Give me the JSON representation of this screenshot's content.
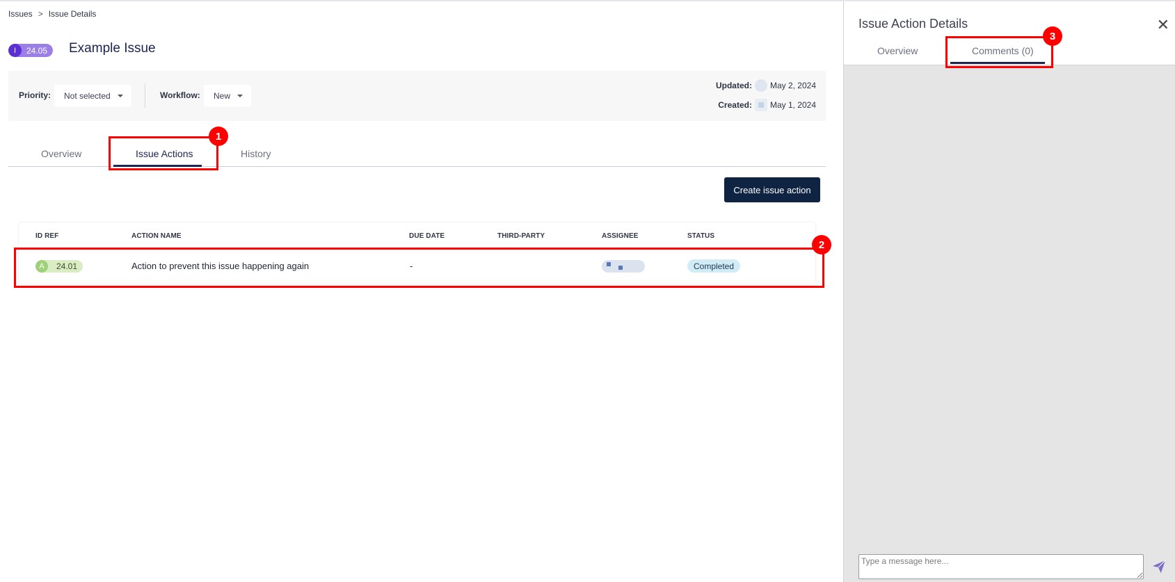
{
  "breadcrumb": {
    "root": "Issues",
    "separator": ">",
    "current": "Issue Details"
  },
  "issue": {
    "badge_letter": "I",
    "badge_number": "24.05",
    "title": "Example Issue"
  },
  "meta": {
    "priority_label": "Priority:",
    "priority_value": "Not selected",
    "workflow_label": "Workflow:",
    "workflow_value": "New",
    "updated_label": "Updated:",
    "updated_date": "May 2, 2024",
    "created_label": "Created:",
    "created_date": "May 1, 2024"
  },
  "tabs": [
    {
      "label": "Overview",
      "active": false
    },
    {
      "label": "Issue Actions",
      "active": true
    },
    {
      "label": "History",
      "active": false
    }
  ],
  "create_button": "Create issue action",
  "table": {
    "headers": [
      "ID REF",
      "ACTION NAME",
      "DUE DATE",
      "THIRD-PARTY",
      "ASSIGNEE",
      "STATUS"
    ],
    "rows": [
      {
        "ref_letter": "A",
        "ref_number": "24.01",
        "action_name": "Action to prevent this issue happening again",
        "due_date": "-",
        "third_party": "",
        "status": "Completed"
      }
    ]
  },
  "annotations": [
    "1",
    "2",
    "3"
  ],
  "side_panel": {
    "title": "Issue Action Details",
    "close_icon": "close-icon",
    "tabs": [
      {
        "label": "Overview",
        "active": false
      },
      {
        "label": "Comments (0)",
        "active": true
      }
    ],
    "message_placeholder": "Type a message here...",
    "send_icon": "paper-plane-icon"
  },
  "colors": {
    "primary": "#0f2342",
    "issue_badge": "#9b7ee6",
    "action_badge": "#d9ecc4",
    "status_completed": "#d2ecf7",
    "annotation": "#ff0000"
  }
}
